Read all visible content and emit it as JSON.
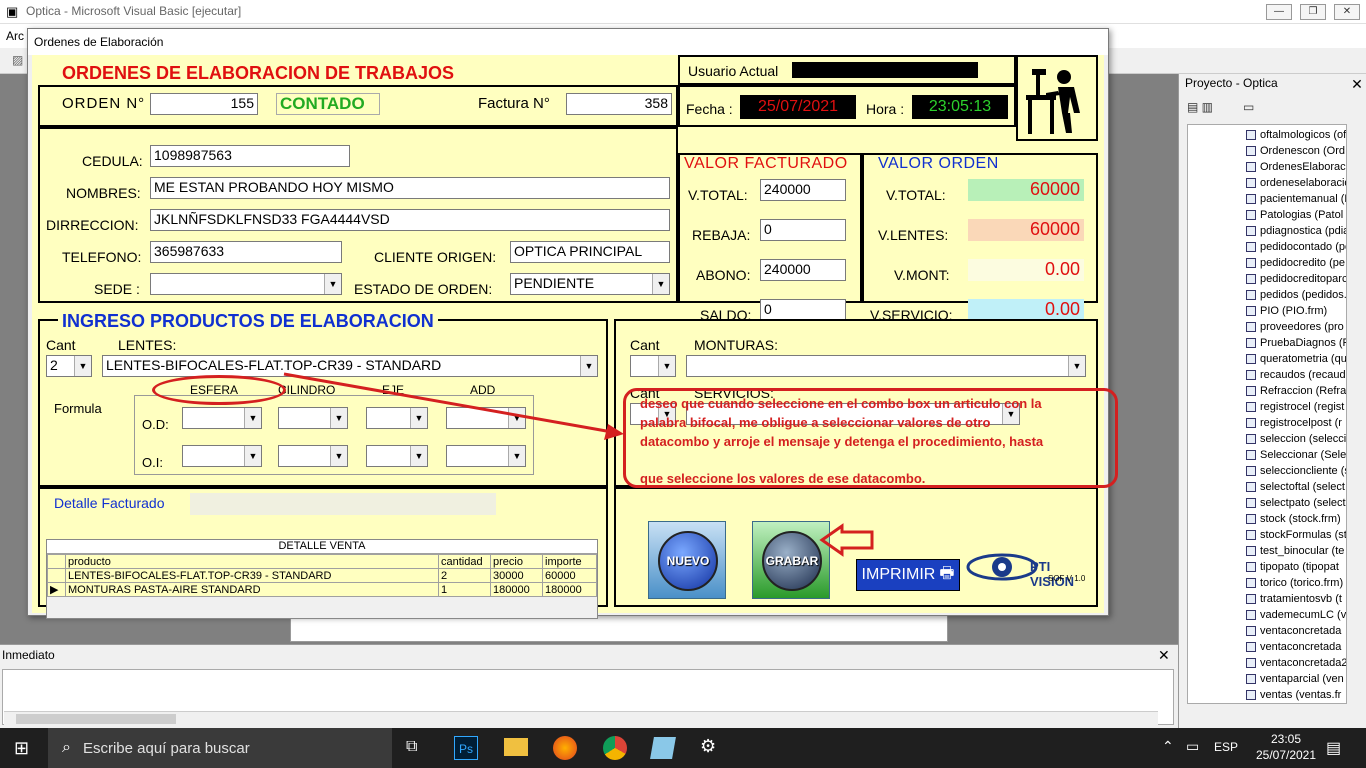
{
  "ide": {
    "title": "Optica - Microsoft Visual Basic [ejecutar]",
    "menu_first": "Arc"
  },
  "form": {
    "title": "Ordenes de Elaboración",
    "heading": "ORDENES DE  ELABORACION DE TRABAJOS",
    "orden_label": "ORDEN N°",
    "orden_value": "155",
    "contado": "CONTADO",
    "factura_label": "Factura N°",
    "factura_value": "358",
    "usuario_label": "Usuario Actual",
    "fecha_label": "Fecha :",
    "fecha_value": "25/07/2021",
    "hora_label": "Hora :",
    "hora_value": "23:05:13",
    "cliente": {
      "cedula_label": "CEDULA:",
      "cedula": "1098987563",
      "nombres_label": "NOMBRES:",
      "nombres": "ME ESTAN PROBANDO HOY MISMO",
      "direccion_label": "DIRRECCION:",
      "direccion": "JKLNÑFSDKLFNSD33 FGA4444VSD",
      "telefono_label": "TELEFONO:",
      "telefono": "365987633",
      "origen_label": "CLIENTE ORIGEN:",
      "origen": "OPTICA PRINCIPAL",
      "sede_label": "SEDE :",
      "sede": "",
      "estado_label": "ESTADO DE ORDEN:",
      "estado": "PENDIENTE"
    },
    "facturado": {
      "title": "VALOR FACTURADO",
      "vtotal_label": "V.TOTAL:",
      "vtotal": "240000",
      "rebaja_label": "REBAJA:",
      "rebaja": "0",
      "abono_label": "ABONO:",
      "abono": "240000",
      "saldo_label": "SALDO:",
      "saldo": "0"
    },
    "orden_vals": {
      "title": "VALOR ORDEN",
      "vtotal_label": "V.TOTAL:",
      "vtotal": "60000",
      "vlentes_label": "V.LENTES:",
      "vlentes": "60000",
      "vmont_label": "V.MONT:",
      "vmont": "0.00",
      "vserv_label": "V.SERVICIO:",
      "vserv": "0.00"
    },
    "ingreso": {
      "title": "INGRESO PRODUCTOS DE ELABORACION",
      "cant_label": "Cant",
      "cant": "2",
      "lentes_label": "LENTES:",
      "lentes": "LENTES-BIFOCALES-FLAT.TOP-CR39  -  STANDARD",
      "formula_label": "Formula",
      "esfera": "ESFERA",
      "cilindro": "CILINDRO",
      "eje": "EJE",
      "add": "ADD",
      "od": "O.D:",
      "oi": "O.I:"
    },
    "monturas": {
      "cant_label": "Cant",
      "monturas_label": "MONTURAS:",
      "cant2_label": "Cant",
      "servicios_label": "SERVICIOS:"
    },
    "detalle": {
      "label": "Detalle Facturado",
      "grid_title": "DETALLE VENTA",
      "columns": [
        "producto",
        "cantidad",
        "precio",
        "importe"
      ],
      "rows": [
        [
          "LENTES-BIFOCALES-FLAT.TOP-CR39  -  STANDARD",
          "2",
          "30000",
          "60000"
        ],
        [
          "MONTURAS  PASTA-AIRE  STANDARD",
          "1",
          "180000",
          "180000"
        ]
      ]
    },
    "buttons": {
      "nuevo": "NUEVO",
      "grabar": "GRABAR",
      "imprimir": "IMPRIMIR"
    },
    "logo": {
      "name": "PTI VISION",
      "sub": "SOF  V 1.0"
    }
  },
  "annotation": {
    "lines": [
      "deseo que cuando seleccione en el combo box un articulo con la",
      "palabra bifocal, me obligue a seleccionar valores de otro",
      "datacombo y arroje el mensaje y detenga el procedimiento, hasta",
      "que seleccione los valores de ese datacombo."
    ]
  },
  "project": {
    "title": "Proyecto - Optica",
    "items": [
      "oftalmologicos (of",
      "Ordenescon (Ord",
      "OrdenesElaboraci",
      "ordeneselaboracio",
      "pacientemanual (F",
      "Patologias (Patol",
      "pdiagnostica (pdia",
      "pedidocontado (pe",
      "pedidocredito (pe",
      "pedidocreditoparc",
      "pedidos (pedidos.",
      "PIO (PIO.frm)",
      "proveedores (pro",
      "PruebaDiagnos (P",
      "queratometria (qu",
      "recaudos (recaud",
      "Refraccion (Refra",
      "registrocel (regist",
      "registrocelpost (r",
      "seleccion (selecci",
      "Seleccionar (Sele",
      "seleccioncliente (s",
      "selectoftal (select",
      "selectpato (select",
      "stock (stock.frm)",
      "stockFormulas (st",
      "test_binocular (te",
      "tipopato (tipopat",
      "torico (torico.frm)",
      "tratamientosvb (t",
      "vademecumLC (va",
      "ventaconcretada",
      "ventaconcretada",
      "ventaconcretada2",
      "ventaparcial (ven",
      "ventas (ventas.fr"
    ]
  },
  "immediate": {
    "title": "Inmediato"
  },
  "taskbar": {
    "search": "Escribe aquí para buscar",
    "lang": "ESP",
    "time": "23:05",
    "date": "25/07/2021"
  },
  "colors": {
    "form_bg": "#ffffc0",
    "heading": "#e01010",
    "accent_blue": "#1030d0",
    "contado": "#22aa22",
    "annotation": "#d42020"
  }
}
